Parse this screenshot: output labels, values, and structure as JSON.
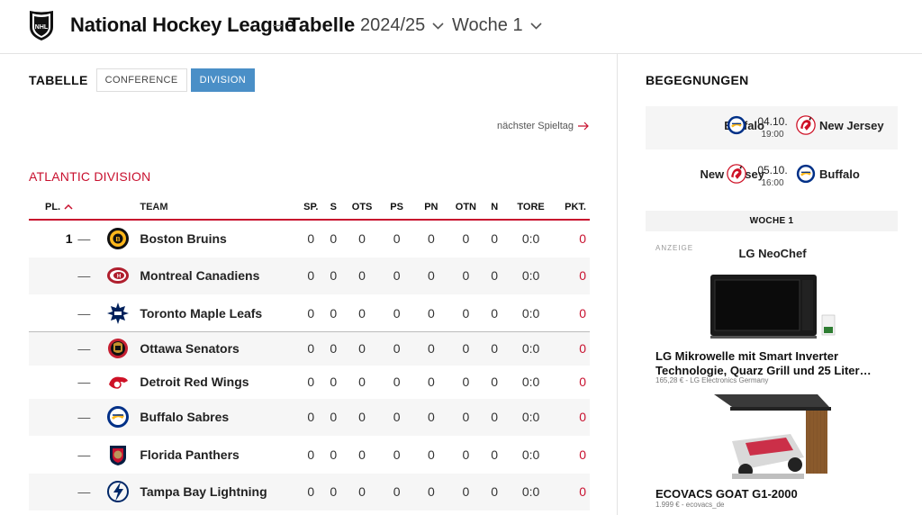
{
  "header": {
    "title": "National Hockey League",
    "separator": "–",
    "subtitle": "Tabelle",
    "season": "2024/25",
    "week": "Woche 1"
  },
  "table_section": {
    "label": "TABELLE",
    "tabs": [
      {
        "label": "CONFERENCE",
        "active": false
      },
      {
        "label": "DIVISION",
        "active": true
      }
    ],
    "next_matchday": "nächster Spieltag",
    "division_title": "ATLANTIC DIVISION",
    "columns": [
      "PL.",
      "TEAM",
      "SP.",
      "S",
      "OTS",
      "PS",
      "PN",
      "OTN",
      "N",
      "TORE",
      "PKT."
    ],
    "rows": [
      {
        "pl": "1",
        "trend": "—",
        "logo": "bruins-logo",
        "team": "Boston Bruins",
        "sp": "0",
        "s": "0",
        "ots": "0",
        "ps": "0",
        "pn": "0",
        "otn": "0",
        "n": "0",
        "tore": "0:0",
        "pkt": "0"
      },
      {
        "pl": "",
        "trend": "—",
        "logo": "canadiens-logo",
        "team": "Montreal Canadiens",
        "sp": "0",
        "s": "0",
        "ots": "0",
        "ps": "0",
        "pn": "0",
        "otn": "0",
        "n": "0",
        "tore": "0:0",
        "pkt": "0"
      },
      {
        "pl": "",
        "trend": "—",
        "logo": "maple-leafs-logo",
        "team": "Toronto Maple Leafs",
        "sp": "0",
        "s": "0",
        "ots": "0",
        "ps": "0",
        "pn": "0",
        "otn": "0",
        "n": "0",
        "tore": "0:0",
        "pkt": "0"
      },
      {
        "pl": "",
        "trend": "—",
        "logo": "senators-logo",
        "team": "Ottawa Senators",
        "sp": "0",
        "s": "0",
        "ots": "0",
        "ps": "0",
        "pn": "0",
        "otn": "0",
        "n": "0",
        "tore": "0:0",
        "pkt": "0"
      },
      {
        "pl": "",
        "trend": "—",
        "logo": "red-wings-logo",
        "team": "Detroit Red Wings",
        "sp": "0",
        "s": "0",
        "ots": "0",
        "ps": "0",
        "pn": "0",
        "otn": "0",
        "n": "0",
        "tore": "0:0",
        "pkt": "0"
      },
      {
        "pl": "",
        "trend": "—",
        "logo": "sabres-logo",
        "team": "Buffalo Sabres",
        "sp": "0",
        "s": "0",
        "ots": "0",
        "ps": "0",
        "pn": "0",
        "otn": "0",
        "n": "0",
        "tore": "0:0",
        "pkt": "0"
      },
      {
        "pl": "",
        "trend": "—",
        "logo": "panthers-logo",
        "team": "Florida Panthers",
        "sp": "0",
        "s": "0",
        "ots": "0",
        "ps": "0",
        "pn": "0",
        "otn": "0",
        "n": "0",
        "tore": "0:0",
        "pkt": "0"
      },
      {
        "pl": "",
        "trend": "—",
        "logo": "lightning-logo",
        "team": "Tampa Bay Lightning",
        "sp": "0",
        "s": "0",
        "ots": "0",
        "ps": "0",
        "pn": "0",
        "otn": "0",
        "n": "0",
        "tore": "0:0",
        "pkt": "0"
      }
    ]
  },
  "sidebar": {
    "title": "BEGEGNUNGEN",
    "matches": [
      {
        "home": "Buffalo",
        "home_logo": "sabres-logo",
        "date": "04.10.",
        "time": "19:00",
        "away": "New Jersey",
        "away_logo": "devils-logo"
      },
      {
        "home": "New Jersey",
        "home_logo": "devils-logo",
        "date": "05.10.",
        "time": "16:00",
        "away": "Buffalo",
        "away_logo": "sabres-logo"
      }
    ],
    "week_label": "WOCHE 1",
    "ad_label": "ANZEIGE",
    "ads": [
      {
        "brand": "LG NeoChef",
        "title": "LG Mikrowelle mit Smart Inverter Technologie, Quarz Grill und 25 Liter…",
        "source": "165,28 € - LG Electronics Germany"
      },
      {
        "title": "ECOVACS GOAT G1-2000",
        "source": "1.999 € - ecovacs_de"
      }
    ]
  },
  "colors": {
    "accent_red": "#c8102e",
    "tab_active": "#4a8fc7"
  }
}
